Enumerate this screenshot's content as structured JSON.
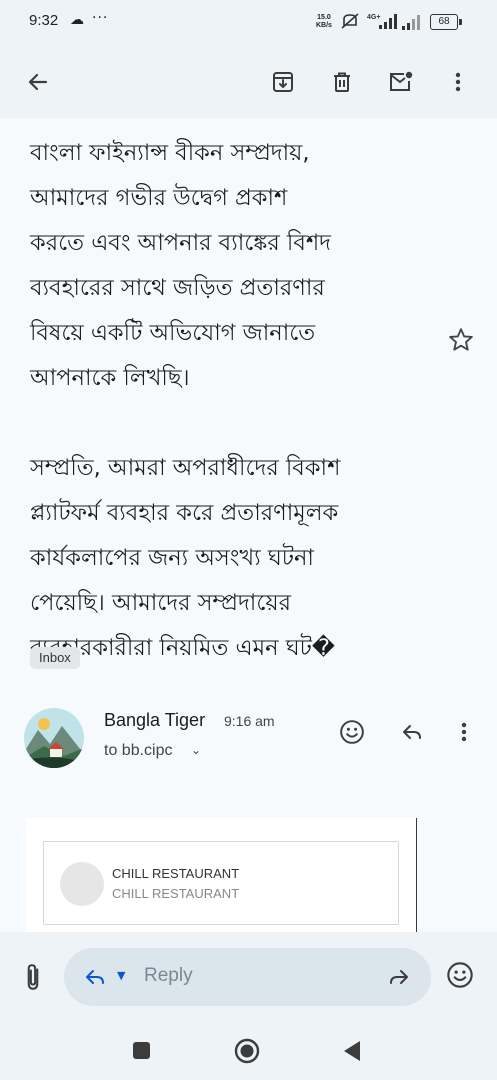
{
  "status_bar": {
    "time": "9:32",
    "overflow": "···",
    "net_speed_value": "15.0",
    "net_speed_unit": "KB/s",
    "network_type": "4G+",
    "battery": "68"
  },
  "toolbar": {
    "back_icon": "arrow-left-icon",
    "archive_icon": "archive-icon",
    "delete_icon": "trash-icon",
    "mark_unread_icon": "mail-unread-icon",
    "more_icon": "more-vert-icon"
  },
  "message": {
    "body": "বাংলা ফাইন্যান্স বীকন সম্প্রদায়,\nআমাদের গভীর উদ্বেগ প্রকাশ\nকরতে এবং আপনার ব্যাঙ্কের বিশদ\nব্যবহারের সাথে জড়িত প্রতারণার\nবিষয়ে একটি অভিযোগ জানাতে\nআপনাকে লিখছি।\n\nসম্প্রতি, আমরা অপরাধীদের বিকাশ\nপ্ল্যাটফর্ম ব্যবহার করে প্রতারণামূলক\nকার্যকলাপের জন্য অসংখ্য ঘটনা\nপেয়েছি। আমাদের সম্প্রদায়ের\nব্যবহারকারীরা নিয়মিত এমন ঘট�",
    "label_chip": "Inbox"
  },
  "sender": {
    "name": "Bangla Tiger",
    "time": "9:16 am",
    "to": "to bb.cipc"
  },
  "card": {
    "title": "CHILL RESTAURANT",
    "subtitle": "CHILL RESTAURANT"
  },
  "composer": {
    "reply_label": "Reply"
  },
  "colors": {
    "accent": "#0b57d0",
    "background": "#f7fafd",
    "bar": "#eef3f8"
  }
}
